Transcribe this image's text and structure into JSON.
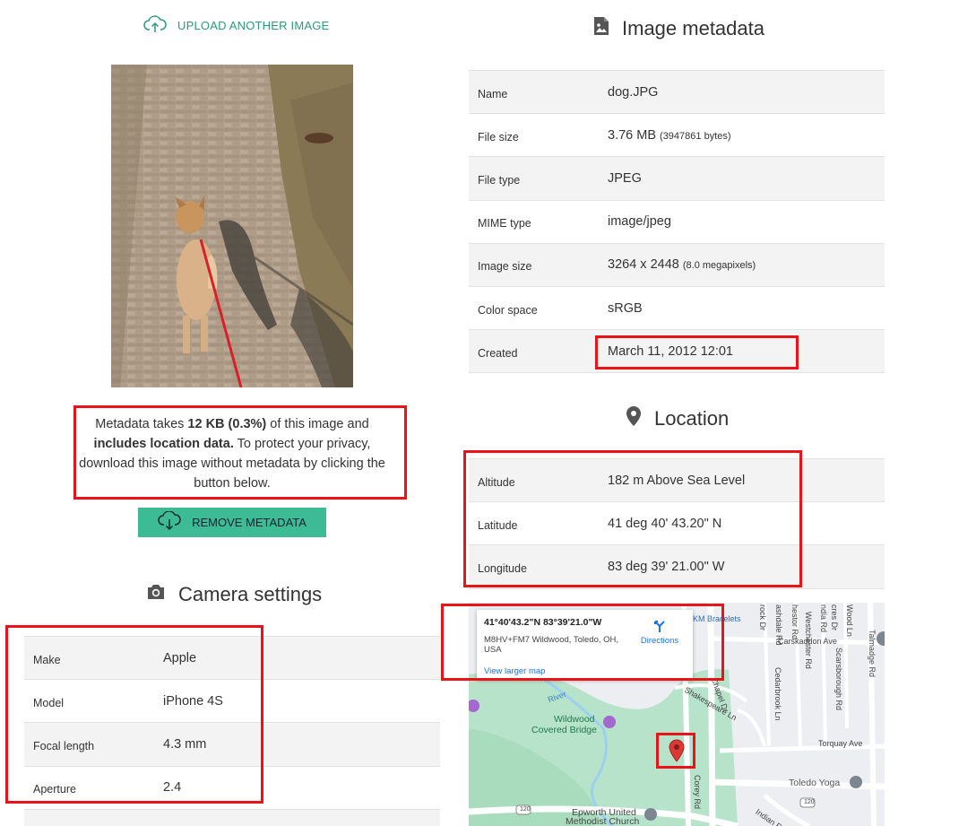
{
  "upload": {
    "label": "UPLOAD ANOTHER IMAGE",
    "icon": "cloud-upload-icon"
  },
  "notice": {
    "prefix": "Metadata takes ",
    "size": "12 KB (0.3%)",
    "middle": " of this image and ",
    "location_flag": "includes location data.",
    "suffix": " To protect your privacy, download this image without metadata by clicking the button below."
  },
  "remove_button": {
    "label": "REMOVE METADATA",
    "icon": "cloud-download-icon"
  },
  "image_metadata": {
    "title": "Image metadata",
    "icon": "image-file-icon",
    "rows": [
      {
        "key": "Name",
        "value": "dog.JPG",
        "extra": ""
      },
      {
        "key": "File size",
        "value": "3.76 MB",
        "extra": "(3947861 bytes)"
      },
      {
        "key": "File type",
        "value": "JPEG",
        "extra": ""
      },
      {
        "key": "MIME type",
        "value": "image/jpeg",
        "extra": ""
      },
      {
        "key": "Image size",
        "value": "3264 x 2448",
        "extra": "(8.0 megapixels)"
      },
      {
        "key": "Color space",
        "value": "sRGB",
        "extra": ""
      },
      {
        "key": "Created",
        "value": "March 11, 2012 12:01",
        "extra": ""
      }
    ]
  },
  "location": {
    "title": "Location",
    "icon": "map-pin-icon",
    "rows": [
      {
        "key": "Altitude",
        "value": "182 m Above Sea Level"
      },
      {
        "key": "Latitude",
        "value": "41 deg 40' 43.20\" N"
      },
      {
        "key": "Longitude",
        "value": "83 deg 39' 21.00\" W"
      }
    ]
  },
  "camera": {
    "title": "Camera settings",
    "icon": "camera-icon",
    "rows": [
      {
        "key": "Make",
        "value": "Apple"
      },
      {
        "key": "Model",
        "value": "iPhone 4S"
      },
      {
        "key": "Focal length",
        "value": "4.3 mm"
      },
      {
        "key": "Aperture",
        "value": "2.4"
      }
    ]
  },
  "map": {
    "coords": "41°40'43.2\"N 83°39'21.0\"W",
    "address": "M8HV+FM7 Wildwood, Toledo, OH, USA",
    "directions": "Directions",
    "larger": "View larger map",
    "labels": {
      "km_bracelets": "KM Bracelets",
      "carskaddon": "Carskaddon Ave",
      "torquay": "Torquay Ave",
      "toledo_yoga": "Toledo Yoga",
      "wildwood": "Wildwood",
      "covered_bridge": "Covered Bridge",
      "epworth": "Epworth United",
      "methodist": "Methodist Church",
      "corey": "Corey Rd",
      "talmadge": "Talmadge Rd",
      "cedarbrook": "Cedarbrook Ln",
      "westchester": "Westchester Rd",
      "scarsborough": "Scarsborough Rd",
      "shakespeare": "Shakespeare Ln",
      "indian": "Indian R",
      "river": "River",
      "chapel": "Chapel Dr",
      "rock": "rock Dr",
      "ashdale": "ashdale Rd",
      "hestor": "hestor Rd",
      "ndia": "ndia Rd",
      "cres": "cres Dr",
      "wood": "Wood Ln",
      "route_a": "120",
      "route_b": "120"
    }
  },
  "colors": {
    "accent": "#3dbb94",
    "link": "#2e9a79",
    "highlight": "#e8141a",
    "pin": "#db3a34"
  }
}
